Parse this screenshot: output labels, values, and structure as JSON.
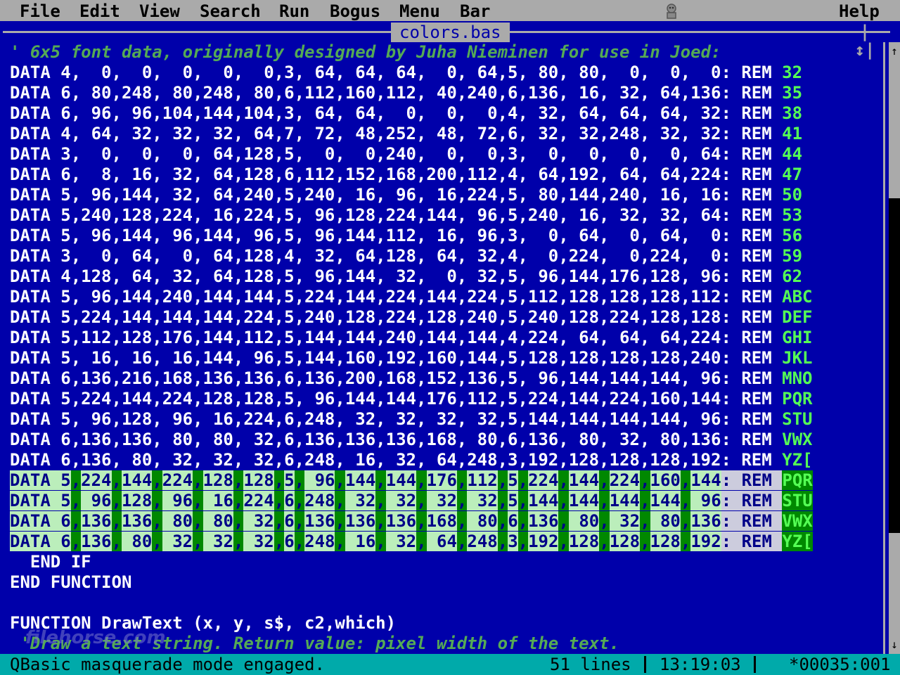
{
  "menu": {
    "items": [
      "File",
      "Edit",
      "View",
      "Search",
      "Run",
      "Bogus",
      "Menu",
      "Bar"
    ],
    "help": "Help"
  },
  "window": {
    "file_title": "colors.bas",
    "resize_glyph": "|↕|"
  },
  "scrollbar": {
    "up_glyph": "↑",
    "down_glyph": "↓"
  },
  "code": {
    "comment": "' 6x5 font data, originally designed by Juha Nieminen for use in Joed:",
    "data_lines": [
      {
        "text": "DATA 4,  0,  0,  0,  0,  0,3, 64, 64, 64,  0, 64,5, 80, 80,  0,  0,  0: REM ",
        "rem": "32"
      },
      {
        "text": "DATA 6, 80,248, 80,248, 80,6,112,160,112, 40,240,6,136, 16, 32, 64,136: REM ",
        "rem": "35"
      },
      {
        "text": "DATA 6, 96, 96,104,144,104,3, 64, 64,  0,  0,  0,4, 32, 64, 64, 64, 32: REM ",
        "rem": "38"
      },
      {
        "text": "DATA 4, 64, 32, 32, 32, 64,7, 72, 48,252, 48, 72,6, 32, 32,248, 32, 32: REM ",
        "rem": "41"
      },
      {
        "text": "DATA 3,  0,  0,  0, 64,128,5,  0,  0,240,  0,  0,3,  0,  0,  0,  0, 64: REM ",
        "rem": "44"
      },
      {
        "text": "DATA 6,  8, 16, 32, 64,128,6,112,152,168,200,112,4, 64,192, 64, 64,224: REM ",
        "rem": "47"
      },
      {
        "text": "DATA 5, 96,144, 32, 64,240,5,240, 16, 96, 16,224,5, 80,144,240, 16, 16: REM ",
        "rem": "50"
      },
      {
        "text": "DATA 5,240,128,224, 16,224,5, 96,128,224,144, 96,5,240, 16, 32, 32, 64: REM ",
        "rem": "53"
      },
      {
        "text": "DATA 5, 96,144, 96,144, 96,5, 96,144,112, 16, 96,3,  0, 64,  0, 64,  0: REM ",
        "rem": "56"
      },
      {
        "text": "DATA 3,  0, 64,  0, 64,128,4, 32, 64,128, 64, 32,4,  0,224,  0,224,  0: REM ",
        "rem": "59"
      },
      {
        "text": "DATA 4,128, 64, 32, 64,128,5, 96,144, 32,  0, 32,5, 96,144,176,128, 96: REM ",
        "rem": "62"
      },
      {
        "text": "DATA 5, 96,144,240,144,144,5,224,144,224,144,224,5,112,128,128,128,112: REM ",
        "rem": "ABC"
      },
      {
        "text": "DATA 5,224,144,144,144,224,5,240,128,224,128,240,5,240,128,224,128,128: REM ",
        "rem": "DEF"
      },
      {
        "text": "DATA 5,112,128,176,144,112,5,144,144,240,144,144,4,224, 64, 64, 64,224: REM ",
        "rem": "GHI"
      },
      {
        "text": "DATA 5, 16, 16, 16,144, 96,5,144,160,192,160,144,5,128,128,128,128,240: REM ",
        "rem": "JKL"
      },
      {
        "text": "DATA 6,136,216,168,136,136,6,136,200,168,152,136,5, 96,144,144,144, 96: REM ",
        "rem": "MNO"
      },
      {
        "text": "DATA 5,224,144,224,128,128,5, 96,144,144,176,112,5,224,144,224,160,144: REM ",
        "rem": "PQR"
      },
      {
        "text": "DATA 5, 96,128, 96, 16,224,6,248, 32, 32, 32, 32,5,144,144,144,144, 96: REM ",
        "rem": "STU"
      },
      {
        "text": "DATA 6,136,136, 80, 80, 32,6,136,136,136,168, 80,6,136, 80, 32, 80,136: REM ",
        "rem": "VWX"
      },
      {
        "text": "DATA 6,136, 80, 32, 32, 32,6,248, 16, 32, 64,248,3,192,128,128,128,192: REM ",
        "rem": "YZ["
      }
    ],
    "selected_lines": [
      {
        "text": "DATA 5,224,144,224,128,128,5, 96,144,144,176,112,5,224,144,224,160,144: REM ",
        "rem": "PQR"
      },
      {
        "text": "DATA 5, 96,128, 96, 16,224,6,248, 32, 32, 32, 32,5,144,144,144,144, 96: REM ",
        "rem": "STU"
      },
      {
        "text": "DATA 6,136,136, 80, 80, 32,6,136,136,136,168, 80,6,136, 80, 32, 80,136: REM ",
        "rem": "VWX"
      },
      {
        "text": "DATA 6,136, 80, 32, 32, 32,6,248, 16, 32, 64,248,3,192,128,128,128,192: REM ",
        "rem": "YZ["
      }
    ],
    "after_lines": [
      {
        "text": "  END IF",
        "type": "code"
      },
      {
        "text": "END FUNCTION",
        "type": "code"
      },
      {
        "text": "",
        "type": "code"
      },
      {
        "text": "FUNCTION DrawText (x, y, s$, c2,which)",
        "type": "code"
      },
      {
        "text": " 'Draw a text string. Return value: pixel width of the text.",
        "type": "comment"
      }
    ]
  },
  "watermark": "filehorse.com",
  "status": {
    "message": "QBasic masquerade mode engaged.",
    "lines": "51 lines",
    "time": "13:19:03",
    "position": "*00035:001"
  },
  "colors": {
    "background": "#0000aa",
    "chrome": "#aaaaaa",
    "status": "#00aaaa",
    "rem_value": "#55ff55"
  }
}
